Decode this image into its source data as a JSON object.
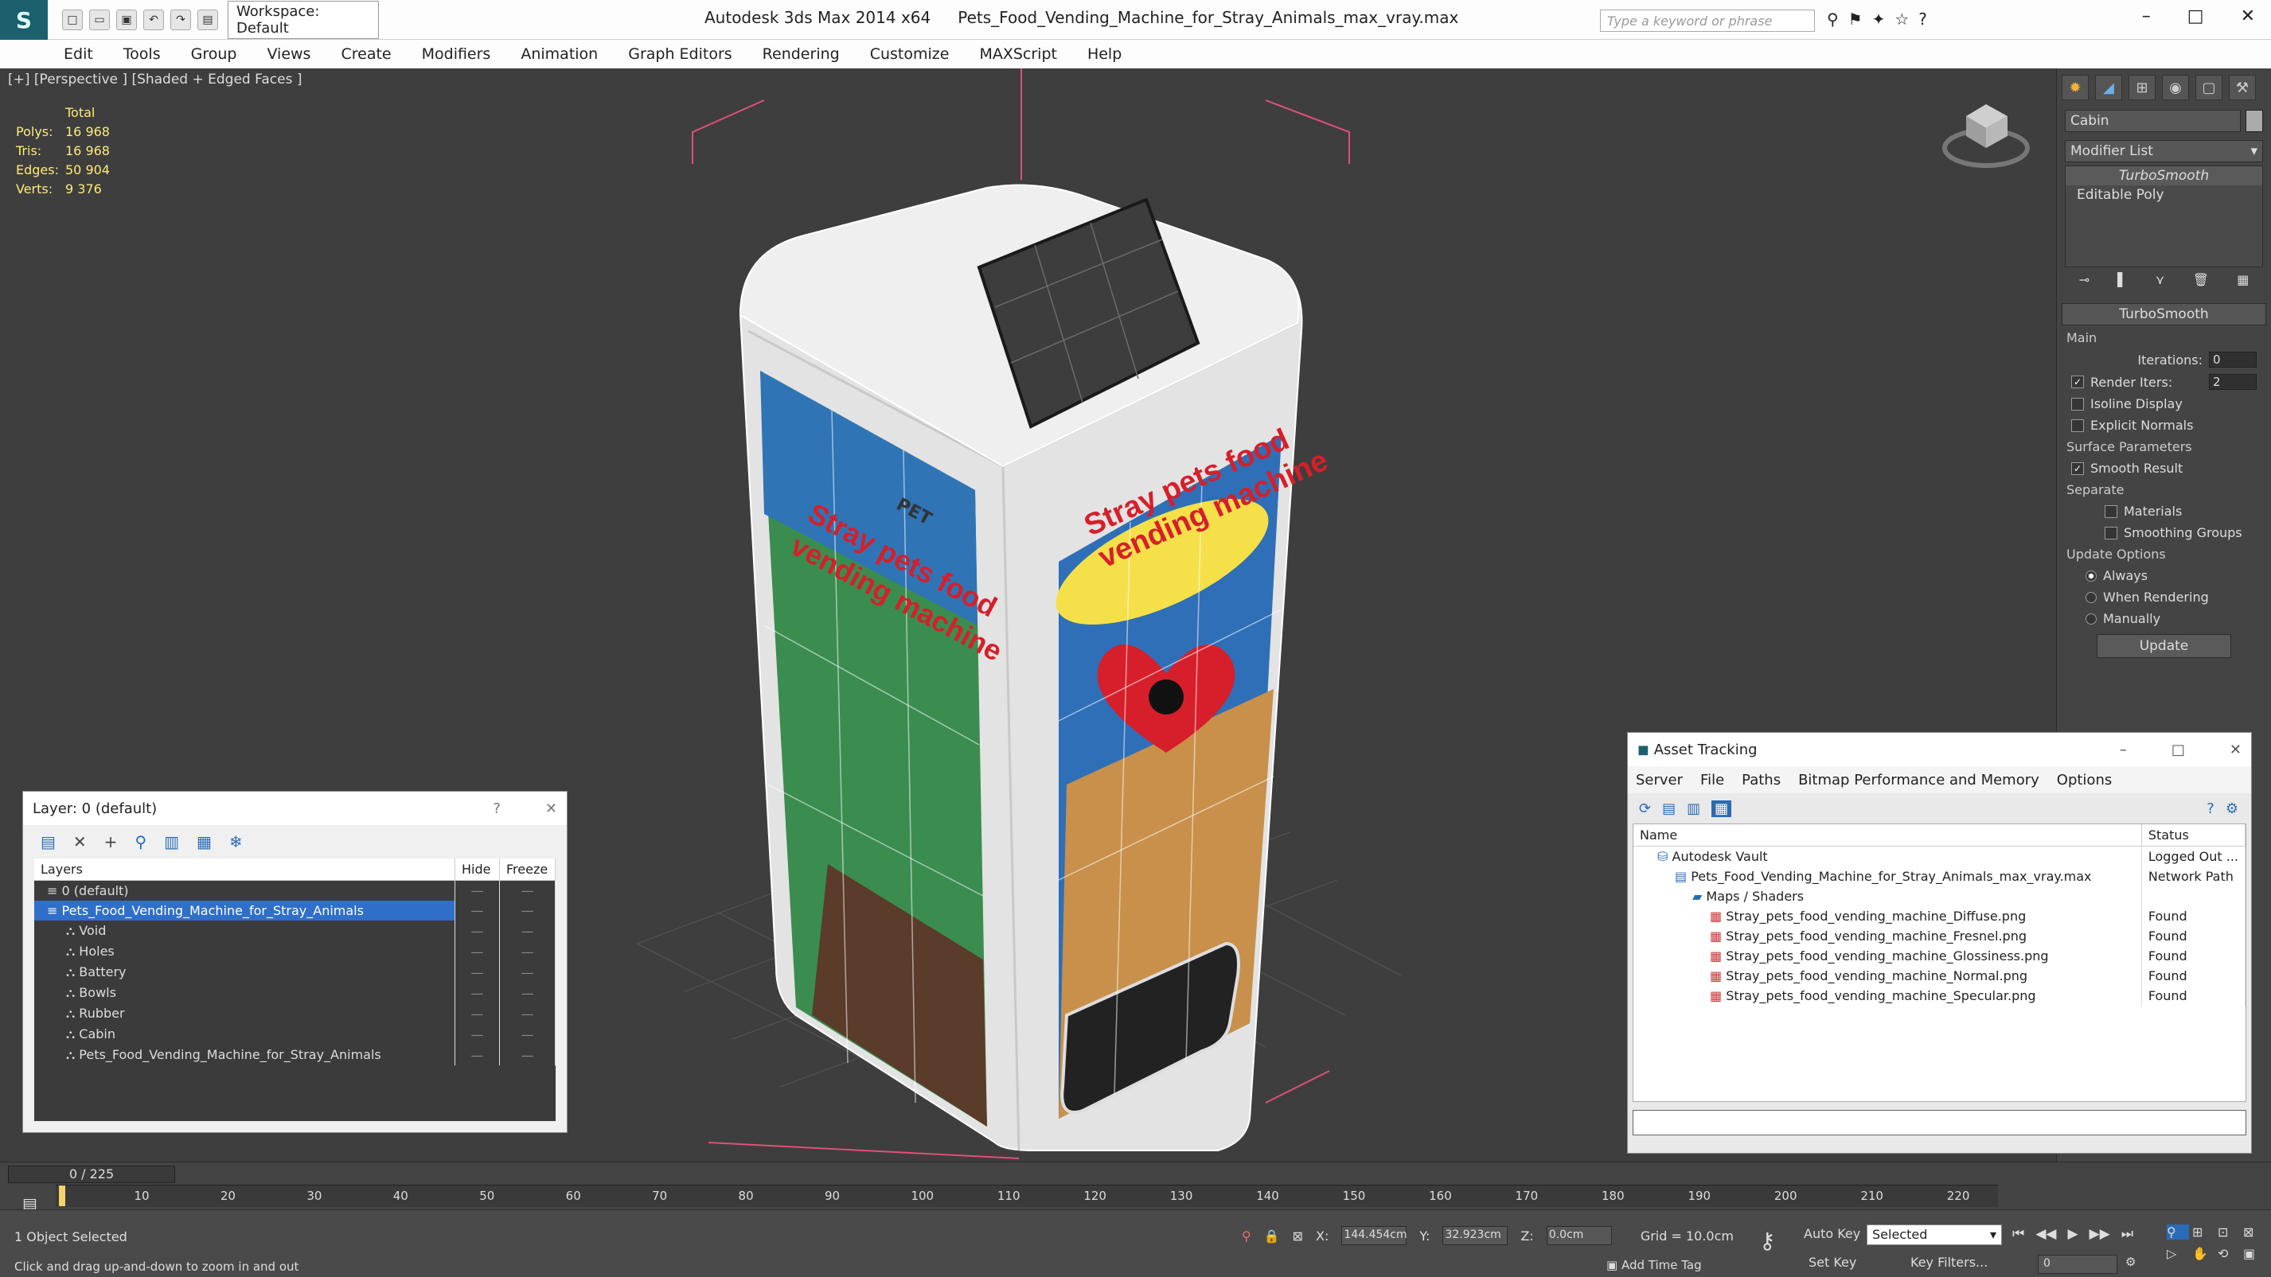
{
  "app": {
    "title": "Autodesk 3ds Max  2014 x64",
    "file": "Pets_Food_Vending_Machine_for_Stray_Animals_max_vray.max",
    "workspace": "Workspace: Default",
    "search_placeholder": "Type a keyword or phrase"
  },
  "menu": [
    "Edit",
    "Tools",
    "Group",
    "Views",
    "Create",
    "Modifiers",
    "Animation",
    "Graph Editors",
    "Rendering",
    "Customize",
    "MAXScript",
    "Help"
  ],
  "viewport": {
    "label": "[+] [Perspective ] [Shaded + Edged Faces ]",
    "stats_header": "Total",
    "stats": [
      {
        "label": "Polys:",
        "value": "16 968"
      },
      {
        "label": "Tris:",
        "value": "16 968"
      },
      {
        "label": "Edges:",
        "value": "50 904"
      },
      {
        "label": "Verts:",
        "value": "9 376"
      }
    ],
    "poster_left": [
      "Stray pets food",
      "vending machine"
    ],
    "poster_right": [
      "Stray pets food",
      "vending machine"
    ],
    "pet_label": "PET"
  },
  "cmd": {
    "object_name": "Cabin",
    "modifier_list": "Modifier List",
    "stack": [
      "TurboSmooth",
      "Editable Poly"
    ],
    "rollout": "TurboSmooth",
    "main": "Main",
    "iterations_label": "Iterations:",
    "iterations": "0",
    "render_iters_label": "Render Iters:",
    "render_iters": "2",
    "isoline": "Isoline Display",
    "explicit": "Explicit Normals",
    "surface": "Surface Parameters",
    "smooth": "Smooth Result",
    "separate": "Separate",
    "materials": "Materials",
    "smoothing_groups": "Smoothing Groups",
    "update_options": "Update Options",
    "always": "Always",
    "when_rendering": "When Rendering",
    "manually": "Manually",
    "update_btn": "Update"
  },
  "layers": {
    "title": "Layer: 0 (default)",
    "help": "?",
    "cols": [
      "Layers",
      "Hide",
      "Freeze"
    ],
    "rows": [
      {
        "name": "0 (default)",
        "indent": 1
      },
      {
        "name": "Pets_Food_Vending_Machine_for_Stray_Animals",
        "indent": 1,
        "selected": true
      },
      {
        "name": "Void",
        "indent": 2
      },
      {
        "name": "Holes",
        "indent": 2
      },
      {
        "name": "Battery",
        "indent": 2
      },
      {
        "name": "Bowls",
        "indent": 2
      },
      {
        "name": "Rubber",
        "indent": 2
      },
      {
        "name": "Cabin",
        "indent": 2
      },
      {
        "name": "Pets_Food_Vending_Machine_for_Stray_Animals",
        "indent": 2
      }
    ]
  },
  "assets": {
    "title": "Asset Tracking",
    "menu": [
      "Server",
      "File",
      "Paths",
      "Bitmap Performance and Memory",
      "Options"
    ],
    "cols": [
      "Name",
      "Status"
    ],
    "rows": [
      {
        "name": "Autodesk Vault",
        "status": "Logged Out ...",
        "indent": 1
      },
      {
        "name": "Pets_Food_Vending_Machine_for_Stray_Animals_max_vray.max",
        "status": "Network Path",
        "indent": 2
      },
      {
        "name": "Maps / Shaders",
        "status": "",
        "indent": 3
      },
      {
        "name": "Stray_pets_food_vending_machine_Diffuse.png",
        "status": "Found",
        "indent": 4
      },
      {
        "name": "Stray_pets_food_vending_machine_Fresnel.png",
        "status": "Found",
        "indent": 4
      },
      {
        "name": "Stray_pets_food_vending_machine_Glossiness.png",
        "status": "Found",
        "indent": 4
      },
      {
        "name": "Stray_pets_food_vending_machine_Normal.png",
        "status": "Found",
        "indent": 4
      },
      {
        "name": "Stray_pets_food_vending_machine_Specular.png",
        "status": "Found",
        "indent": 4
      }
    ]
  },
  "timeline": {
    "frame": "0 / 225",
    "ticks": [
      "10",
      "20",
      "30",
      "40",
      "50",
      "60",
      "70",
      "80",
      "90",
      "100",
      "110",
      "120",
      "130",
      "140",
      "150",
      "160",
      "170",
      "180",
      "190",
      "200",
      "210",
      "220"
    ]
  },
  "status": {
    "selected": "1 Object Selected",
    "hint": "Click and drag up-and-down to zoom in and out",
    "x_label": "X:",
    "x": "144.454cm",
    "y_label": "Y:",
    "y": "32.923cm",
    "z_label": "Z:",
    "z": "0.0cm",
    "grid": "Grid = 10.0cm",
    "add_time_tag": "Add Time Tag",
    "auto_key": "Auto Key",
    "set_key": "Set Key",
    "selected_dropdown": "Selected",
    "key_filters": "Key Filters...",
    "frame_field": "0"
  }
}
